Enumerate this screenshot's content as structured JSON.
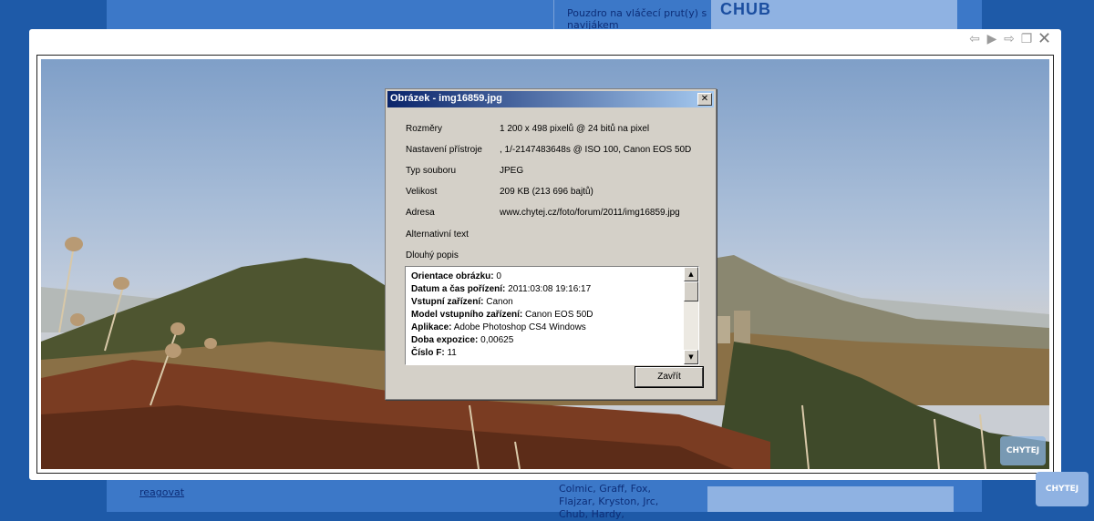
{
  "background": {
    "top_link": "Pouzdro na vláčecí prut(y) s navijákem",
    "banner_logo": "CHUB",
    "reply_link": "reagovat",
    "brands": "Colmic, Graff, Fox, Flajzar, Kryston, Jrc, Chub, Hardy,",
    "corner_logo": "CHYTEJ"
  },
  "lightbox": {
    "nav_icons": [
      "prev-icon",
      "play-icon",
      "next-icon",
      "popout-icon",
      "close-icon"
    ],
    "watermark": "CHYTEJ"
  },
  "dialog": {
    "title": "Obrázek - img16859.jpg",
    "properties": [
      {
        "label": "Rozměry",
        "value": "1 200 x 498 pixelů @ 24 bitů na pixel"
      },
      {
        "label": "Nastavení přístroje",
        "value": ", 1/-2147483648s @ ISO 100, Canon EOS 50D"
      },
      {
        "label": "Typ souboru",
        "value": "JPEG"
      },
      {
        "label": "Velikost",
        "value": "209 KB (213 696 bajtů)"
      },
      {
        "label": "Adresa",
        "value": "www.chytej.cz/foto/forum/2011/img16859.jpg"
      },
      {
        "label": "Alternativní text",
        "value": ""
      },
      {
        "label": "Dlouhý popis",
        "value": ""
      }
    ],
    "details": [
      {
        "key": "Orientace obrázku:",
        "value": "0"
      },
      {
        "key": "Datum a čas pořízení:",
        "value": "2011:03:08 19:16:17"
      },
      {
        "key": "Vstupní zařízení:",
        "value": "Canon"
      },
      {
        "key": "Model vstupního zařízení:",
        "value": "Canon EOS 50D"
      },
      {
        "key": "Aplikace:",
        "value": "Adobe Photoshop CS4 Windows"
      },
      {
        "key": "Doba expozice:",
        "value": "0,00625"
      },
      {
        "key": "Číslo F:",
        "value": "11"
      }
    ],
    "close_button": "Zavřít",
    "close_glyph": "✕"
  }
}
